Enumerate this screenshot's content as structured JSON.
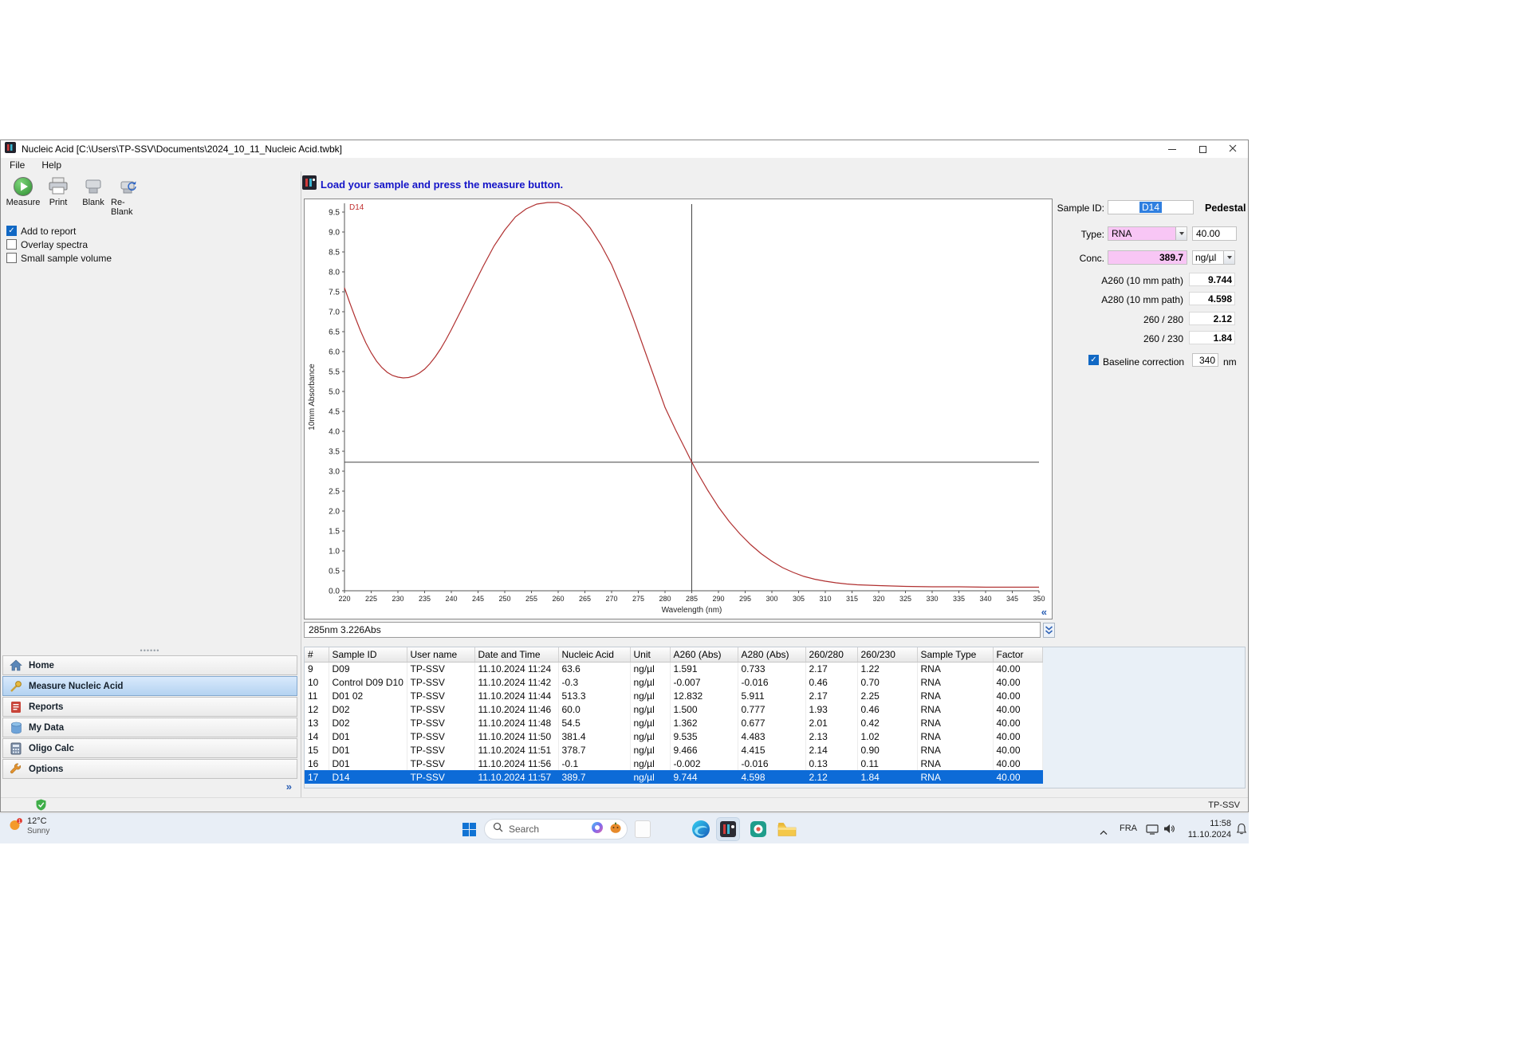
{
  "window": {
    "title": "Nucleic Acid  [C:\\Users\\TP-SSV\\Documents\\2024_10_11_Nucleic Acid.twbk]"
  },
  "menu": {
    "items": [
      {
        "label": "File"
      },
      {
        "label": "Help"
      }
    ]
  },
  "toolbar": {
    "buttons": [
      {
        "label": "Measure"
      },
      {
        "label": "Print"
      },
      {
        "label": "Blank"
      },
      {
        "label": "Re-Blank"
      }
    ]
  },
  "options": {
    "checkboxes": [
      {
        "label": "Add to report",
        "checked": true
      },
      {
        "label": "Overlay spectra",
        "checked": false
      },
      {
        "label": "Small sample volume",
        "checked": false
      }
    ]
  },
  "header": {
    "message": "Load your sample and press the measure button."
  },
  "chart_data": {
    "type": "line",
    "title": "",
    "xlabel": "Wavelength (nm)",
    "ylabel": "10mm Absorbance",
    "xlim": [
      220,
      350
    ],
    "ylim": [
      0,
      9.75
    ],
    "x_tick_step": 5,
    "y_tick_step": 0.5,
    "y_tick_max": 9.5,
    "grid": false,
    "cursor": {
      "wavelength": 285,
      "absorbance": 3.226
    },
    "cursor_label": "285nm 3.226Abs",
    "series": [
      {
        "name": "D14",
        "color": "#b03030",
        "points": [
          [
            220,
            7.6
          ],
          [
            221,
            7.22
          ],
          [
            222,
            6.86
          ],
          [
            223,
            6.52
          ],
          [
            224,
            6.22
          ],
          [
            225,
            5.97
          ],
          [
            226,
            5.76
          ],
          [
            227,
            5.6
          ],
          [
            228,
            5.48
          ],
          [
            229,
            5.4
          ],
          [
            230,
            5.36
          ],
          [
            231,
            5.34
          ],
          [
            232,
            5.35
          ],
          [
            233,
            5.39
          ],
          [
            234,
            5.46
          ],
          [
            235,
            5.56
          ],
          [
            236,
            5.7
          ],
          [
            237,
            5.87
          ],
          [
            238,
            6.07
          ],
          [
            239,
            6.3
          ],
          [
            240,
            6.55
          ],
          [
            242,
            7.08
          ],
          [
            244,
            7.62
          ],
          [
            246,
            8.15
          ],
          [
            248,
            8.65
          ],
          [
            250,
            9.05
          ],
          [
            252,
            9.38
          ],
          [
            254,
            9.58
          ],
          [
            256,
            9.7
          ],
          [
            258,
            9.74
          ],
          [
            260,
            9.74
          ],
          [
            262,
            9.64
          ],
          [
            264,
            9.42
          ],
          [
            266,
            9.1
          ],
          [
            268,
            8.68
          ],
          [
            270,
            8.18
          ],
          [
            272,
            7.55
          ],
          [
            274,
            6.85
          ],
          [
            276,
            6.1
          ],
          [
            278,
            5.35
          ],
          [
            280,
            4.6
          ],
          [
            282,
            4.03
          ],
          [
            284,
            3.5
          ],
          [
            285,
            3.23
          ],
          [
            286,
            2.98
          ],
          [
            288,
            2.52
          ],
          [
            290,
            2.1
          ],
          [
            292,
            1.74
          ],
          [
            294,
            1.43
          ],
          [
            296,
            1.16
          ],
          [
            298,
            0.93
          ],
          [
            300,
            0.74
          ],
          [
            302,
            0.58
          ],
          [
            304,
            0.46
          ],
          [
            306,
            0.36
          ],
          [
            308,
            0.29
          ],
          [
            310,
            0.24
          ],
          [
            312,
            0.2
          ],
          [
            314,
            0.17
          ],
          [
            316,
            0.15
          ],
          [
            320,
            0.13
          ],
          [
            325,
            0.11
          ],
          [
            330,
            0.1
          ],
          [
            335,
            0.1
          ],
          [
            340,
            0.09
          ],
          [
            345,
            0.09
          ],
          [
            350,
            0.09
          ]
        ]
      }
    ]
  },
  "sample_panel": {
    "sample_id_label": "Sample ID:",
    "sample_id_value": "D14",
    "mode": "Pedestal",
    "type_label": "Type:",
    "type_value": "RNA",
    "factor_value": "40.00",
    "conc_label": "Conc.",
    "conc_value": "389.7",
    "conc_unit": "ng/µl",
    "rows": [
      {
        "label": "A260 (10 mm path)",
        "value": "9.744"
      },
      {
        "label": "A280 (10 mm path)",
        "value": "4.598"
      },
      {
        "label": "260 / 280",
        "value": "2.12"
      },
      {
        "label": "260 / 230",
        "value": "1.84"
      }
    ],
    "baseline": {
      "label": "Baseline correction",
      "checked": true,
      "value": "340",
      "unit": "nm"
    }
  },
  "table": {
    "columns": [
      "#",
      "Sample ID",
      "User name",
      "Date and Time",
      "Nucleic Acid",
      "Unit",
      "A260 (Abs)",
      "A280 (Abs)",
      "260/280",
      "260/230",
      "Sample Type",
      "Factor"
    ],
    "rows": [
      [
        "9",
        "D09",
        "TP-SSV",
        "11.10.2024 11:24",
        "63.6",
        "ng/µl",
        "1.591",
        "0.733",
        "2.17",
        "1.22",
        "RNA",
        "40.00"
      ],
      [
        "10",
        "Control D09 D10",
        "TP-SSV",
        "11.10.2024 11:42",
        "-0.3",
        "ng/µl",
        "-0.007",
        "-0.016",
        "0.46",
        "0.70",
        "RNA",
        "40.00"
      ],
      [
        "11",
        "D01 02",
        "TP-SSV",
        "11.10.2024 11:44",
        "513.3",
        "ng/µl",
        "12.832",
        "5.911",
        "2.17",
        "2.25",
        "RNA",
        "40.00"
      ],
      [
        "12",
        "D02",
        "TP-SSV",
        "11.10.2024 11:46",
        "60.0",
        "ng/µl",
        "1.500",
        "0.777",
        "1.93",
        "0.46",
        "RNA",
        "40.00"
      ],
      [
        "13",
        "D02",
        "TP-SSV",
        "11.10.2024 11:48",
        "54.5",
        "ng/µl",
        "1.362",
        "0.677",
        "2.01",
        "0.42",
        "RNA",
        "40.00"
      ],
      [
        "14",
        "D01",
        "TP-SSV",
        "11.10.2024 11:50",
        "381.4",
        "ng/µl",
        "9.535",
        "4.483",
        "2.13",
        "1.02",
        "RNA",
        "40.00"
      ],
      [
        "15",
        "D01",
        "TP-SSV",
        "11.10.2024 11:51",
        "378.7",
        "ng/µl",
        "9.466",
        "4.415",
        "2.14",
        "0.90",
        "RNA",
        "40.00"
      ],
      [
        "16",
        "D01",
        "TP-SSV",
        "11.10.2024 11:56",
        "-0.1",
        "ng/µl",
        "-0.002",
        "-0.016",
        "0.13",
        "0.11",
        "RNA",
        "40.00"
      ],
      [
        "17",
        "D14",
        "TP-SSV",
        "11.10.2024 11:57",
        "389.7",
        "ng/µl",
        "9.744",
        "4.598",
        "2.12",
        "1.84",
        "RNA",
        "40.00"
      ]
    ],
    "selected_index": 8
  },
  "sidebar": {
    "items": [
      {
        "label": "Home",
        "icon": "home",
        "selected": false
      },
      {
        "label": "Measure Nucleic Acid",
        "icon": "measure",
        "selected": true
      },
      {
        "label": "Reports",
        "icon": "reports",
        "selected": false
      },
      {
        "label": "My Data",
        "icon": "my-data",
        "selected": false
      },
      {
        "label": "Oligo Calc",
        "icon": "oligo-calc",
        "selected": false
      },
      {
        "label": "Options",
        "icon": "options",
        "selected": false
      }
    ]
  },
  "statusbar": {
    "user": "TP-SSV"
  },
  "taskbar": {
    "weather": {
      "temp": "12°C",
      "condition": "Sunny"
    },
    "search": {
      "placeholder": "Search"
    },
    "tray": {
      "language": "FRA",
      "time": "11:58",
      "date": "11.10.2024"
    }
  },
  "colors": {
    "selection_blue": "#0d6bd7",
    "field_pink": "#f8c6f5",
    "curve_red": "#b03030",
    "header_blue": "#1414c8"
  }
}
